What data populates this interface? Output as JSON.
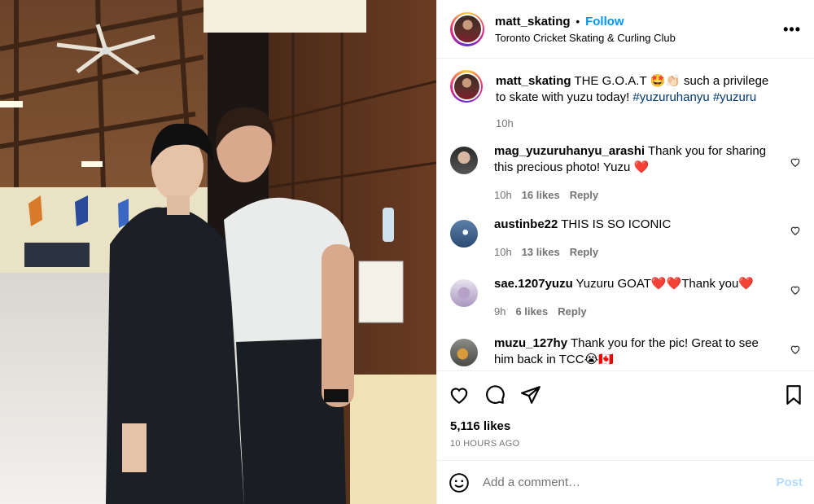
{
  "colors": {
    "accent": "#0095f6",
    "like_red": "#ed4956",
    "muted": "#737373"
  },
  "post": {
    "username": "matt_skating",
    "follow_label": "Follow",
    "location": "Toronto Cricket Skating & Curling Club",
    "more_icon": "more-horizontal-icon",
    "caption": {
      "username": "matt_skating",
      "text": " THE G.O.A.T ",
      "emojis": "🤩👏🏻",
      "text2": " such a privilege to skate with yuzu today! ",
      "tag1": "#yuzuruhanyu",
      "tag2": "#yuzuru",
      "time": "10h"
    },
    "comments": [
      {
        "username": "mag_yuzuruhanyu_arashi",
        "text": " Thank you for sharing this precious photo! Yuzu ",
        "emoji": "❤️",
        "time": "10h",
        "likes": "16 likes",
        "reply": "Reply"
      },
      {
        "username": "austinbe22",
        "text": " THIS IS SO ICONIC",
        "emoji": "",
        "time": "10h",
        "likes": "13 likes",
        "reply": "Reply"
      },
      {
        "username": "sae.1207yuzu",
        "text": " Yuzuru GOAT",
        "emoji": "❤️❤️",
        "text2": "Thank you",
        "emoji2": "❤️",
        "time": "9h",
        "likes": "6 likes",
        "reply": "Reply"
      },
      {
        "username": "muzu_127hy",
        "text": " Thank you for the pic! Great to see him back in TCC",
        "emoji": "😭🇨🇦"
      }
    ],
    "likes_count": "5,116 likes",
    "posted_ago": "10 HOURS AGO",
    "add_comment_placeholder": "Add a comment…",
    "post_label": "Post"
  }
}
